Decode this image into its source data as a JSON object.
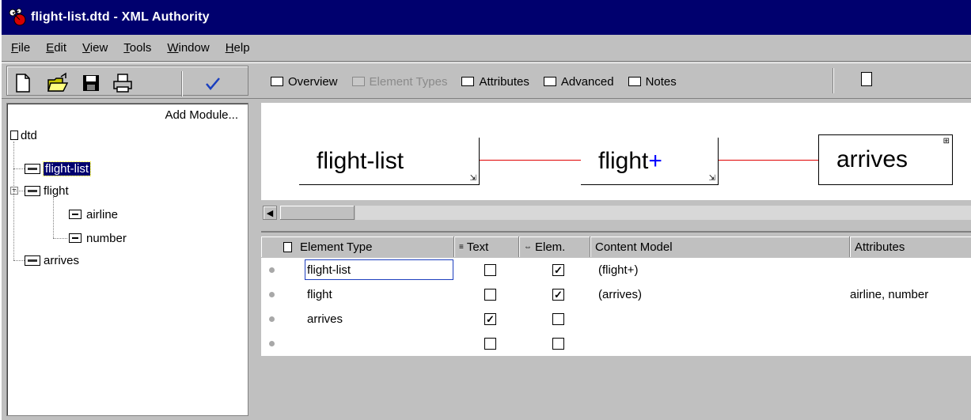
{
  "window": {
    "title": "flight-list.dtd - XML Authority",
    "accent": "#00006e"
  },
  "menu": [
    "File",
    "Edit",
    "View",
    "Tools",
    "Window",
    "Help"
  ],
  "toolbar": {
    "icons": [
      "new-document-icon",
      "open-folder-icon",
      "save-disk-icon",
      "print-icon",
      "validate-check-icon"
    ],
    "tabs": [
      {
        "label": "Overview",
        "enabled": true
      },
      {
        "label": "Element Types",
        "enabled": false
      },
      {
        "label": "Attributes",
        "enabled": true
      },
      {
        "label": "Advanced",
        "enabled": true
      },
      {
        "label": "Notes",
        "enabled": true
      }
    ]
  },
  "left_pane": {
    "add_module": "Add Module...",
    "root": "dtd",
    "tree": [
      {
        "label": "flight-list",
        "type": "element",
        "selected": true
      },
      {
        "label": "flight",
        "type": "element",
        "selected": false
      },
      {
        "label": "airline",
        "type": "attribute",
        "selected": false
      },
      {
        "label": "number",
        "type": "attribute",
        "selected": false
      },
      {
        "label": "arrives",
        "type": "element",
        "selected": false
      }
    ]
  },
  "diagram": {
    "nodes": [
      {
        "name": "flight-list",
        "suffix": ""
      },
      {
        "name": "flight",
        "suffix": "+"
      },
      {
        "name": "arrives",
        "suffix": ""
      }
    ],
    "connector_color": "#e00000"
  },
  "grid": {
    "columns": [
      "Element Type",
      "Text",
      "Elem.",
      "Content Model",
      "Attributes"
    ],
    "rows": [
      {
        "element_type": "flight-list",
        "text": false,
        "elem": true,
        "content_model": "(flight+)",
        "attributes": ""
      },
      {
        "element_type": "flight",
        "text": false,
        "elem": true,
        "content_model": "(arrives)",
        "attributes": "airline, number"
      },
      {
        "element_type": "arrives",
        "text": true,
        "elem": false,
        "content_model": "",
        "attributes": ""
      },
      {
        "element_type": "",
        "text": false,
        "elem": false,
        "content_model": "",
        "attributes": ""
      }
    ]
  }
}
